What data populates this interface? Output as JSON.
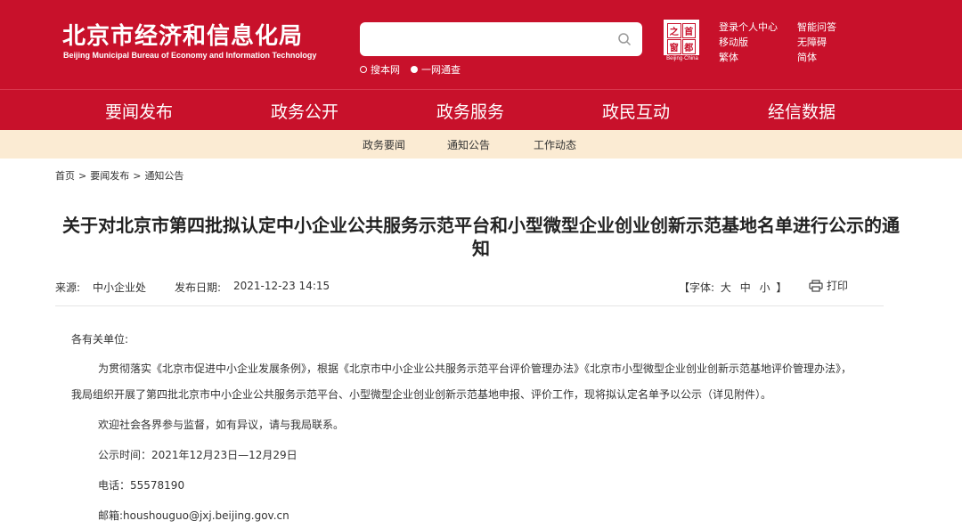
{
  "header": {
    "org_cn": "北京市经济和信息化局",
    "org_en": "Beijing Municipal Bureau of Economy and Information Technology",
    "search": {
      "placeholder": "",
      "opt1": "搜本网",
      "opt2": "一网通查"
    },
    "seal": {
      "chars": [
        "首",
        "都",
        "之",
        "窗"
      ],
      "caption": "Beijing·China"
    },
    "links": [
      "登录个人中心",
      "智能问答",
      "移动版",
      "无障碍",
      "繁体",
      "简体"
    ]
  },
  "nav": {
    "items": [
      "要闻发布",
      "政务公开",
      "政务服务",
      "政民互动",
      "经信数据"
    ],
    "active_index": 0
  },
  "subnav": {
    "items": [
      "政务要闻",
      "通知公告",
      "工作动态"
    ]
  },
  "breadcrumb": [
    "首页",
    "要闻发布",
    "通知公告"
  ],
  "article": {
    "title": "关于对北京市第四批拟认定中小企业公共服务示范平台和小型微型企业创业创新示范基地名单进行公示的通知",
    "source_label": "来源:",
    "source": "中小企业处",
    "date_label": "发布日期:",
    "date": "2021-12-23 14:15",
    "font_label_open": "【字体:",
    "font_large": "大",
    "font_medium": "中",
    "font_small": "小",
    "font_label_close": "】",
    "print": "打印",
    "greeting": "各有关单位:",
    "para1": "为贯彻落实《北京市促进中小企业发展条例》，根据《北京市中小企业公共服务示范平台评价管理办法》《北京市小型微型企业创业创新示范基地评价管理办法》，我局组织开展了第四批北京市中小企业公共服务示范平台、小型微型企业创业创新示范基地申报、评价工作，现将拟认定名单予以公示（详见附件）。",
    "para2": "欢迎社会各界参与监督，如有异议，请与我局联系。",
    "period": "公示时间：2021年12月23日—12月29日",
    "phone": "电话：55578190",
    "email": "邮箱:houshouguo@jxj.beijing.gov.cn"
  },
  "colors": {
    "brand_red": "#c8112b",
    "subnav_bg": "#fbebd3"
  }
}
